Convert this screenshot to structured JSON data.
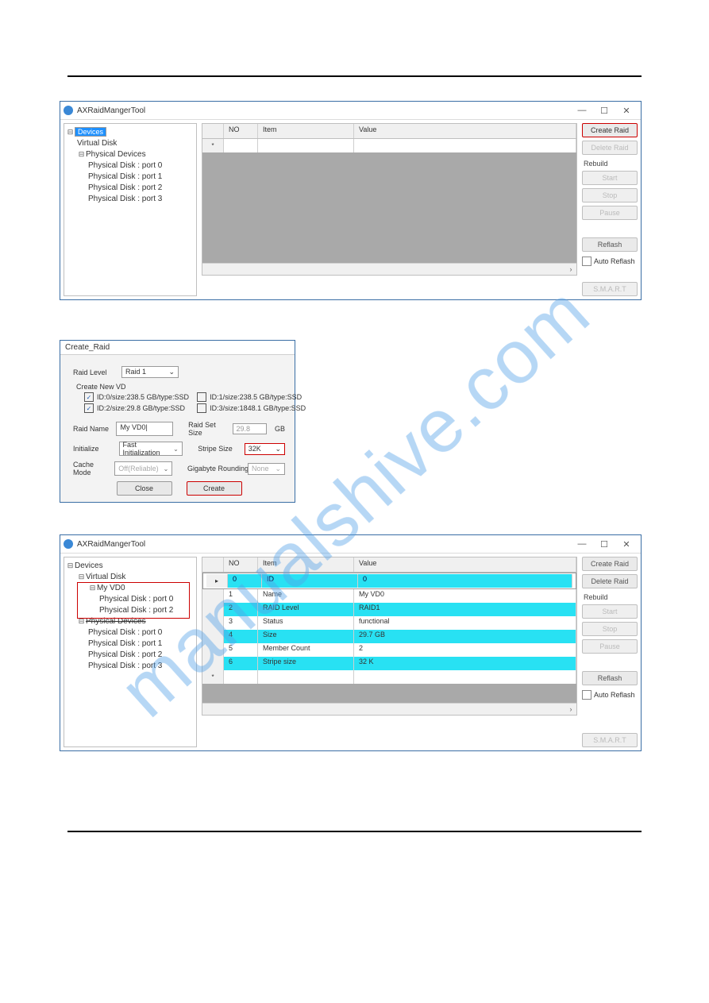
{
  "watermark": "manualshive.com",
  "app_title": "AXRaidMangerTool",
  "win_buttons": {
    "min": "—",
    "max": "☐",
    "close": "✕"
  },
  "screenshot1": {
    "tree": {
      "root": "Devices",
      "virtual_disk": "Virtual Disk",
      "physical_devices": "Physical Devices",
      "ports": [
        "Physical Disk : port 0",
        "Physical Disk : port 1",
        "Physical Disk : port 2",
        "Physical Disk : port 3"
      ]
    },
    "grid_headers": {
      "no": "NO",
      "item": "Item",
      "value": "Value"
    },
    "side": {
      "create": "Create Raid",
      "delete": "Delete Raid",
      "rebuild": "Rebuild",
      "start": "Start",
      "stop": "Stop",
      "pause": "Pause",
      "reflash": "Reflash",
      "auto": "Auto Reflash",
      "smart": "S.M.A.R.T"
    }
  },
  "dialog": {
    "title": "Create_Raid",
    "labels": {
      "raid_level": "Raid Level",
      "create_new_vd": "Create New VD",
      "raid_name": "Raid Name",
      "initialize": "Initialize",
      "cache_mode": "Cache Mode",
      "raid_set_size": "Raid Set Size",
      "stripe_size": "Stripe Size",
      "gb_rounding": "Gigabyte Rounding",
      "gb": "GB"
    },
    "raid_level_value": "Raid 1",
    "disks": {
      "d0": "ID:0/size:238.5  GB/type:SSD",
      "d1": "ID:1/size:238.5  GB/type:SSD",
      "d2": "ID:2/size:29.8  GB/type:SSD",
      "d3": "ID:3/size:1848.1  GB/type:SSD",
      "d0_checked": "✓",
      "d2_checked": "✓"
    },
    "raid_name_value": "My VD0|",
    "initialize_value": "Fast Initialization",
    "cache_mode_value": "Off(Reliable)",
    "raid_set_size_value": "29.8",
    "stripe_size_value": "32K",
    "gb_rounding_value": "None",
    "close_btn": "Close",
    "create_btn": "Create"
  },
  "screenshot3": {
    "tree": {
      "root": "Devices",
      "virtual_disk": "Virtual Disk",
      "my_vd": "My VD0",
      "vd_ports": [
        "Physical Disk : port 0",
        "Physical Disk : port 2"
      ],
      "physical_devices": "Physical Devices",
      "ports": [
        "Physical Disk : port 0",
        "Physical Disk : port 1",
        "Physical Disk : port 2",
        "Physical Disk : port 3"
      ]
    },
    "grid_headers": {
      "no": "NO",
      "item": "Item",
      "value": "Value"
    },
    "rows": [
      {
        "no": "0",
        "item": "ID",
        "value": "0",
        "sel": true
      },
      {
        "no": "1",
        "item": "Name",
        "value": "My VD0"
      },
      {
        "no": "2",
        "item": "RAID Level",
        "value": "RAID1",
        "cyan": true
      },
      {
        "no": "3",
        "item": "Status",
        "value": "functional"
      },
      {
        "no": "4",
        "item": "Size",
        "value": "29.7 GB",
        "cyan": true
      },
      {
        "no": "5",
        "item": "Member Count",
        "value": "2"
      },
      {
        "no": "6",
        "item": "Stripe size",
        "value": "32 K",
        "cyan": true
      }
    ],
    "side": {
      "create": "Create Raid",
      "delete": "Delete Raid",
      "rebuild": "Rebuild",
      "start": "Start",
      "stop": "Stop",
      "pause": "Pause",
      "reflash": "Reflash",
      "auto": "Auto Reflash",
      "smart": "S.M.A.R.T"
    }
  }
}
